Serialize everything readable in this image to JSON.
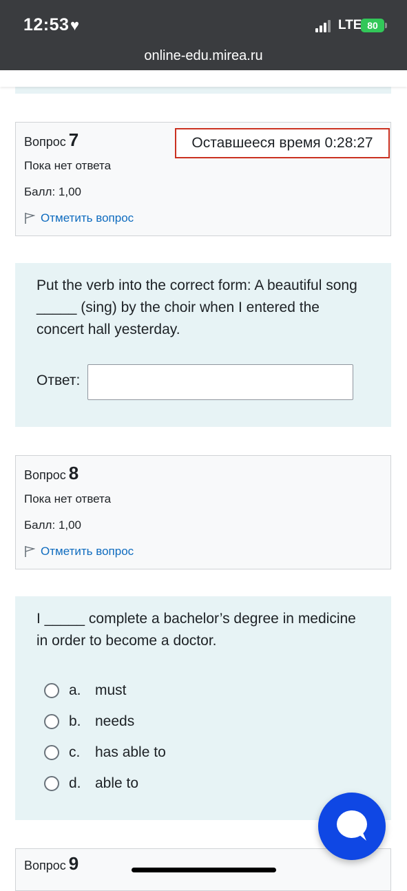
{
  "status_bar": {
    "time": "12:53",
    "network": "LTE",
    "battery": "80"
  },
  "browser": {
    "url": "online-edu.mirea.ru"
  },
  "timer": {
    "label": "Оставшееся время",
    "value": "0:28:27"
  },
  "questions": [
    {
      "label": "Вопрос",
      "number": "7",
      "state": "Пока нет ответа",
      "grade": "Балл: 1,00",
      "flag_label": "Отметить вопрос",
      "text": "Put the verb into the correct form: A beautiful song _____ (sing) by the choir when I entered the concert hall yesterday.",
      "answer_label": "Ответ:",
      "answer_value": ""
    },
    {
      "label": "Вопрос",
      "number": "8",
      "state": "Пока нет ответа",
      "grade": "Балл: 1,00",
      "flag_label": "Отметить вопрос",
      "text": "I _____ complete a bachelor’s degree in medicine in order to become a doctor.",
      "options": [
        {
          "letter": "a.",
          "text": "must"
        },
        {
          "letter": "b.",
          "text": "needs"
        },
        {
          "letter": "c.",
          "text": "has able to"
        },
        {
          "letter": "d.",
          "text": "able to"
        }
      ]
    },
    {
      "label": "Вопрос",
      "number": "9"
    }
  ],
  "icons": {
    "flag": "flag-icon",
    "chat": "chat-bubble-icon",
    "heart": "heart-icon"
  },
  "colors": {
    "status_bg": "#3a3c3f",
    "link": "#0f6cbf",
    "timer_border": "#ca3120",
    "content_bg": "#e7f3f5",
    "chat": "#0f47e4"
  }
}
